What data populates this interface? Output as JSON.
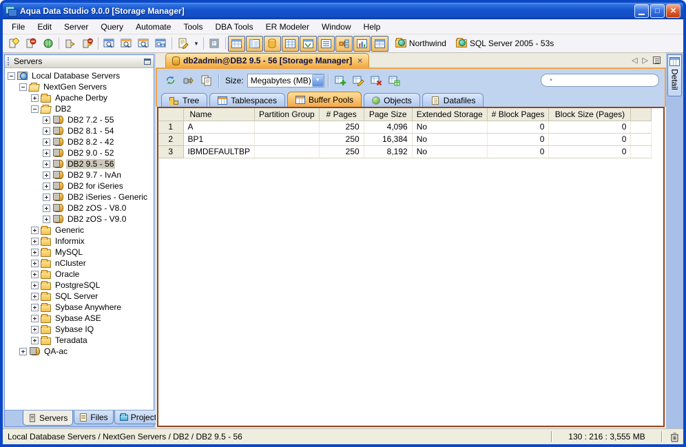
{
  "window": {
    "title": "Aqua Data Studio 9.0.0 [Storage Manager]"
  },
  "menu": {
    "items": [
      "File",
      "Edit",
      "Server",
      "Query",
      "Automate",
      "Tools",
      "DBA Tools",
      "ER Modeler",
      "Window",
      "Help"
    ]
  },
  "toolbar": {
    "northwind_label": "Northwind",
    "sqlserver_label": "SQL Server 2005 - 53s"
  },
  "sidebar": {
    "panel_title": "Servers",
    "tree": [
      "Local Database Servers",
      "NextGen Servers",
      "Apache Derby",
      "DB2",
      "DB2 7.2 - 55",
      "DB2 8.1 - 54",
      "DB2 8.2 - 42",
      "DB2 9.0 - 52",
      "DB2 9.5 - 56",
      "DB2 9.7 - IvAn",
      "DB2 for iSeries",
      "DB2 iSeries - Generic",
      "DB2 zOS - V8.0",
      "DB2 zOS - V9.0",
      "Generic",
      "Informix",
      "MySQL",
      "nCluster",
      "Oracle",
      "PostgreSQL",
      "SQL Server",
      "Sybase Anywhere",
      "Sybase ASE",
      "Sybase IQ",
      "Teradata",
      "QA-ac"
    ],
    "tabs": {
      "servers": "Servers",
      "files": "Files",
      "projects": "Projects"
    }
  },
  "document": {
    "tab_label": "db2admin@DB2 9.5 - 56 [Storage Manager]",
    "close_x": "×",
    "size_label": "Size:",
    "size_value": "Megabytes (MB)",
    "subtabs": {
      "tree": "Tree",
      "tablespaces": "Tablespaces",
      "bufferpools": "Buffer Pools",
      "objects": "Objects",
      "datafiles": "Datafiles"
    },
    "detail_tab": "Detail"
  },
  "table": {
    "columns": [
      "Name",
      "Partition Group",
      "# Pages",
      "Page Size",
      "Extended Storage",
      "# Block Pages",
      "Block Size (Pages)"
    ],
    "rows": [
      {
        "num": "1",
        "cells": [
          "A",
          "",
          "250",
          "4,096",
          "No",
          "0",
          "0"
        ]
      },
      {
        "num": "2",
        "cells": [
          "BP1",
          "",
          "250",
          "16,384",
          "No",
          "0",
          "0"
        ]
      },
      {
        "num": "3",
        "cells": [
          "IBMDEFAULTBP",
          "",
          "250",
          "8,192",
          "No",
          "0",
          "0"
        ]
      }
    ]
  },
  "statusbar": {
    "breadcrumb": "Local Database Servers / NextGen Servers / DB2 / DB2 9.5 - 56",
    "metrics": "130 : 216 : 3,555 MB"
  }
}
